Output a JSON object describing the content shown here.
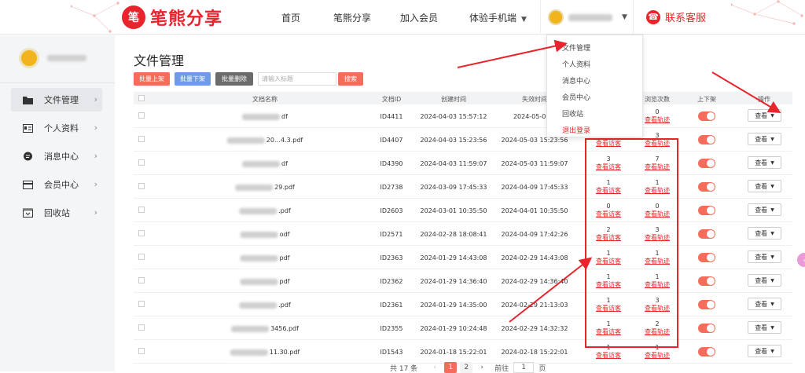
{
  "brand": {
    "name": "笔熊分享",
    "mark": "笔"
  },
  "nav": [
    {
      "label": "首页"
    },
    {
      "label": "笔熊分享"
    },
    {
      "label": "加入会员"
    },
    {
      "label": "体验手机端",
      "caret": "▼"
    }
  ],
  "user_nav": {
    "caret": "▼"
  },
  "service": {
    "label": "联系客服"
  },
  "sidebar": {
    "items": [
      {
        "label": "文件管理",
        "icon": "folder-icon",
        "active": true
      },
      {
        "label": "个人资料",
        "icon": "id-card-icon"
      },
      {
        "label": "消息中心",
        "icon": "message-icon"
      },
      {
        "label": "会员中心",
        "icon": "vip-card-icon"
      },
      {
        "label": "回收站",
        "icon": "recycle-bin-icon"
      }
    ],
    "arrow": "›"
  },
  "main": {
    "title": "文件管理"
  },
  "toolbar": {
    "batch_on": "批量上架",
    "batch_off": "批量下架",
    "batch_delete": "批量删除",
    "search_placeholder": "请输入标题",
    "search": "搜索"
  },
  "table": {
    "headers": {
      "name": "文档名称",
      "id": "文档ID",
      "created": "创建时间",
      "expires": "失效时间",
      "downloads": "下载次数",
      "views": "浏览次数",
      "shelf": "上下架",
      "ops": "操作"
    },
    "link_downloads": "查看访客",
    "link_views": "查看轨迹",
    "view_label": "查看",
    "view_caret": "▼",
    "rows": [
      {
        "name": "df",
        "id": "ID4411",
        "created": "2024-04-03 15:57:12",
        "expires": "2024-05-03 1",
        "downloads": "",
        "views": "0"
      },
      {
        "name": "20…4.3.pdf",
        "id": "ID4407",
        "created": "2024-04-03 15:23:56",
        "expires": "2024-05-03 15:23:56",
        "downloads": "6",
        "views": "3"
      },
      {
        "name": "df",
        "id": "ID4390",
        "created": "2024-04-03 11:59:07",
        "expires": "2024-05-03 11:59:07",
        "downloads": "3",
        "views": "7"
      },
      {
        "name": "29.pdf",
        "id": "ID2738",
        "created": "2024-03-09 17:45:33",
        "expires": "2024-04-09 17:45:33",
        "downloads": "1",
        "views": "1"
      },
      {
        "name": ".pdf",
        "id": "ID2603",
        "created": "2024-03-01 10:35:50",
        "expires": "2024-04-01 10:35:50",
        "downloads": "0",
        "views": "0"
      },
      {
        "name": "odf",
        "id": "ID2571",
        "created": "2024-02-28 18:08:41",
        "expires": "2024-04-09 17:42:26",
        "downloads": "2",
        "views": "3"
      },
      {
        "name": "pdf",
        "id": "ID2363",
        "created": "2024-01-29 14:43:08",
        "expires": "2024-02-29 14:43:08",
        "downloads": "1",
        "views": "1"
      },
      {
        "name": "pdf",
        "id": "ID2362",
        "created": "2024-01-29 14:36:40",
        "expires": "2024-02-29 14:36:40",
        "downloads": "1",
        "views": "1"
      },
      {
        "name": ".pdf",
        "id": "ID2361",
        "created": "2024-01-29 14:35:00",
        "expires": "2024-02-29 21:13:03",
        "downloads": "1",
        "views": "3"
      },
      {
        "name": "3456.pdf",
        "id": "ID2355",
        "created": "2024-01-29 10:24:48",
        "expires": "2024-02-29 14:32:32",
        "downloads": "1",
        "views": "2"
      },
      {
        "name": "11.30.pdf",
        "id": "ID1543",
        "created": "2024-01-18 15:22:01",
        "expires": "2024-02-18 15:22:01",
        "downloads": "1",
        "views": "1"
      }
    ]
  },
  "dropdown": {
    "items": [
      "文件管理",
      "个人资料",
      "消息中心",
      "会员中心",
      "回收站"
    ],
    "logout": "退出登录"
  },
  "pager": {
    "total": "共 17 条",
    "prev": "‹",
    "pages": [
      "1",
      "2"
    ],
    "next": "›",
    "goto": "前往",
    "page_value": "1",
    "page_suffix": "页"
  },
  "float_tab": "‹"
}
